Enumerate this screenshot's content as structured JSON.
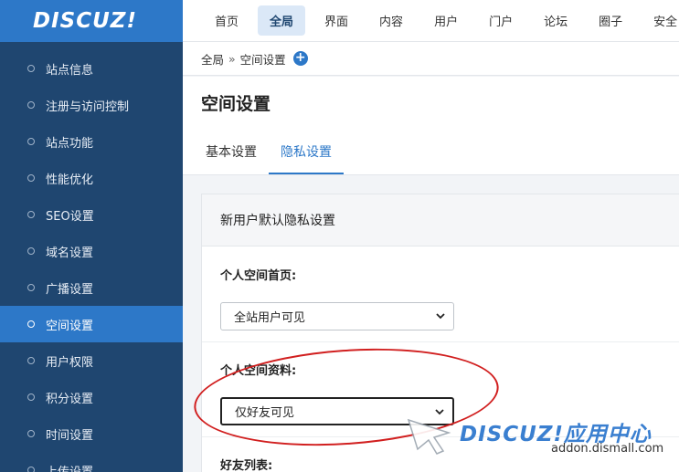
{
  "logo": {
    "text": "DISCUZ!"
  },
  "sidebar": {
    "items": [
      {
        "label": "站点信息",
        "active": false
      },
      {
        "label": "注册与访问控制",
        "active": false
      },
      {
        "label": "站点功能",
        "active": false
      },
      {
        "label": "性能优化",
        "active": false
      },
      {
        "label": "SEO设置",
        "active": false
      },
      {
        "label": "域名设置",
        "active": false
      },
      {
        "label": "广播设置",
        "active": false
      },
      {
        "label": "空间设置",
        "active": true
      },
      {
        "label": "用户权限",
        "active": false
      },
      {
        "label": "积分设置",
        "active": false
      },
      {
        "label": "时间设置",
        "active": false
      },
      {
        "label": "上传设置",
        "active": false
      }
    ]
  },
  "topnav": {
    "tabs": [
      {
        "label": "首页",
        "active": false
      },
      {
        "label": "全局",
        "active": true
      },
      {
        "label": "界面",
        "active": false
      },
      {
        "label": "内容",
        "active": false
      },
      {
        "label": "用户",
        "active": false
      },
      {
        "label": "门户",
        "active": false
      },
      {
        "label": "论坛",
        "active": false
      },
      {
        "label": "圈子",
        "active": false
      },
      {
        "label": "安全",
        "active": false
      }
    ]
  },
  "breadcrumb": {
    "root": "全局",
    "separator": "»",
    "current": "空间设置",
    "add_icon": "+"
  },
  "page": {
    "title": "空间设置",
    "subtabs": [
      {
        "label": "基本设置",
        "active": false
      },
      {
        "label": "隐私设置",
        "active": true
      }
    ]
  },
  "form": {
    "section_title": "新用户默认隐私设置",
    "fields": [
      {
        "label": "个人空间首页:",
        "value": "全站用户可见"
      },
      {
        "label": "个人空间资料:",
        "value": "仅好友可见"
      },
      {
        "label": "好友列表:"
      }
    ]
  },
  "watermark": {
    "brand": "DISCUZ!应用中心",
    "url": "addon.dismall.com"
  },
  "colors": {
    "sidebar_bg": "#1f4670",
    "accent": "#2d78c8",
    "annotation": "#d11f1f"
  }
}
